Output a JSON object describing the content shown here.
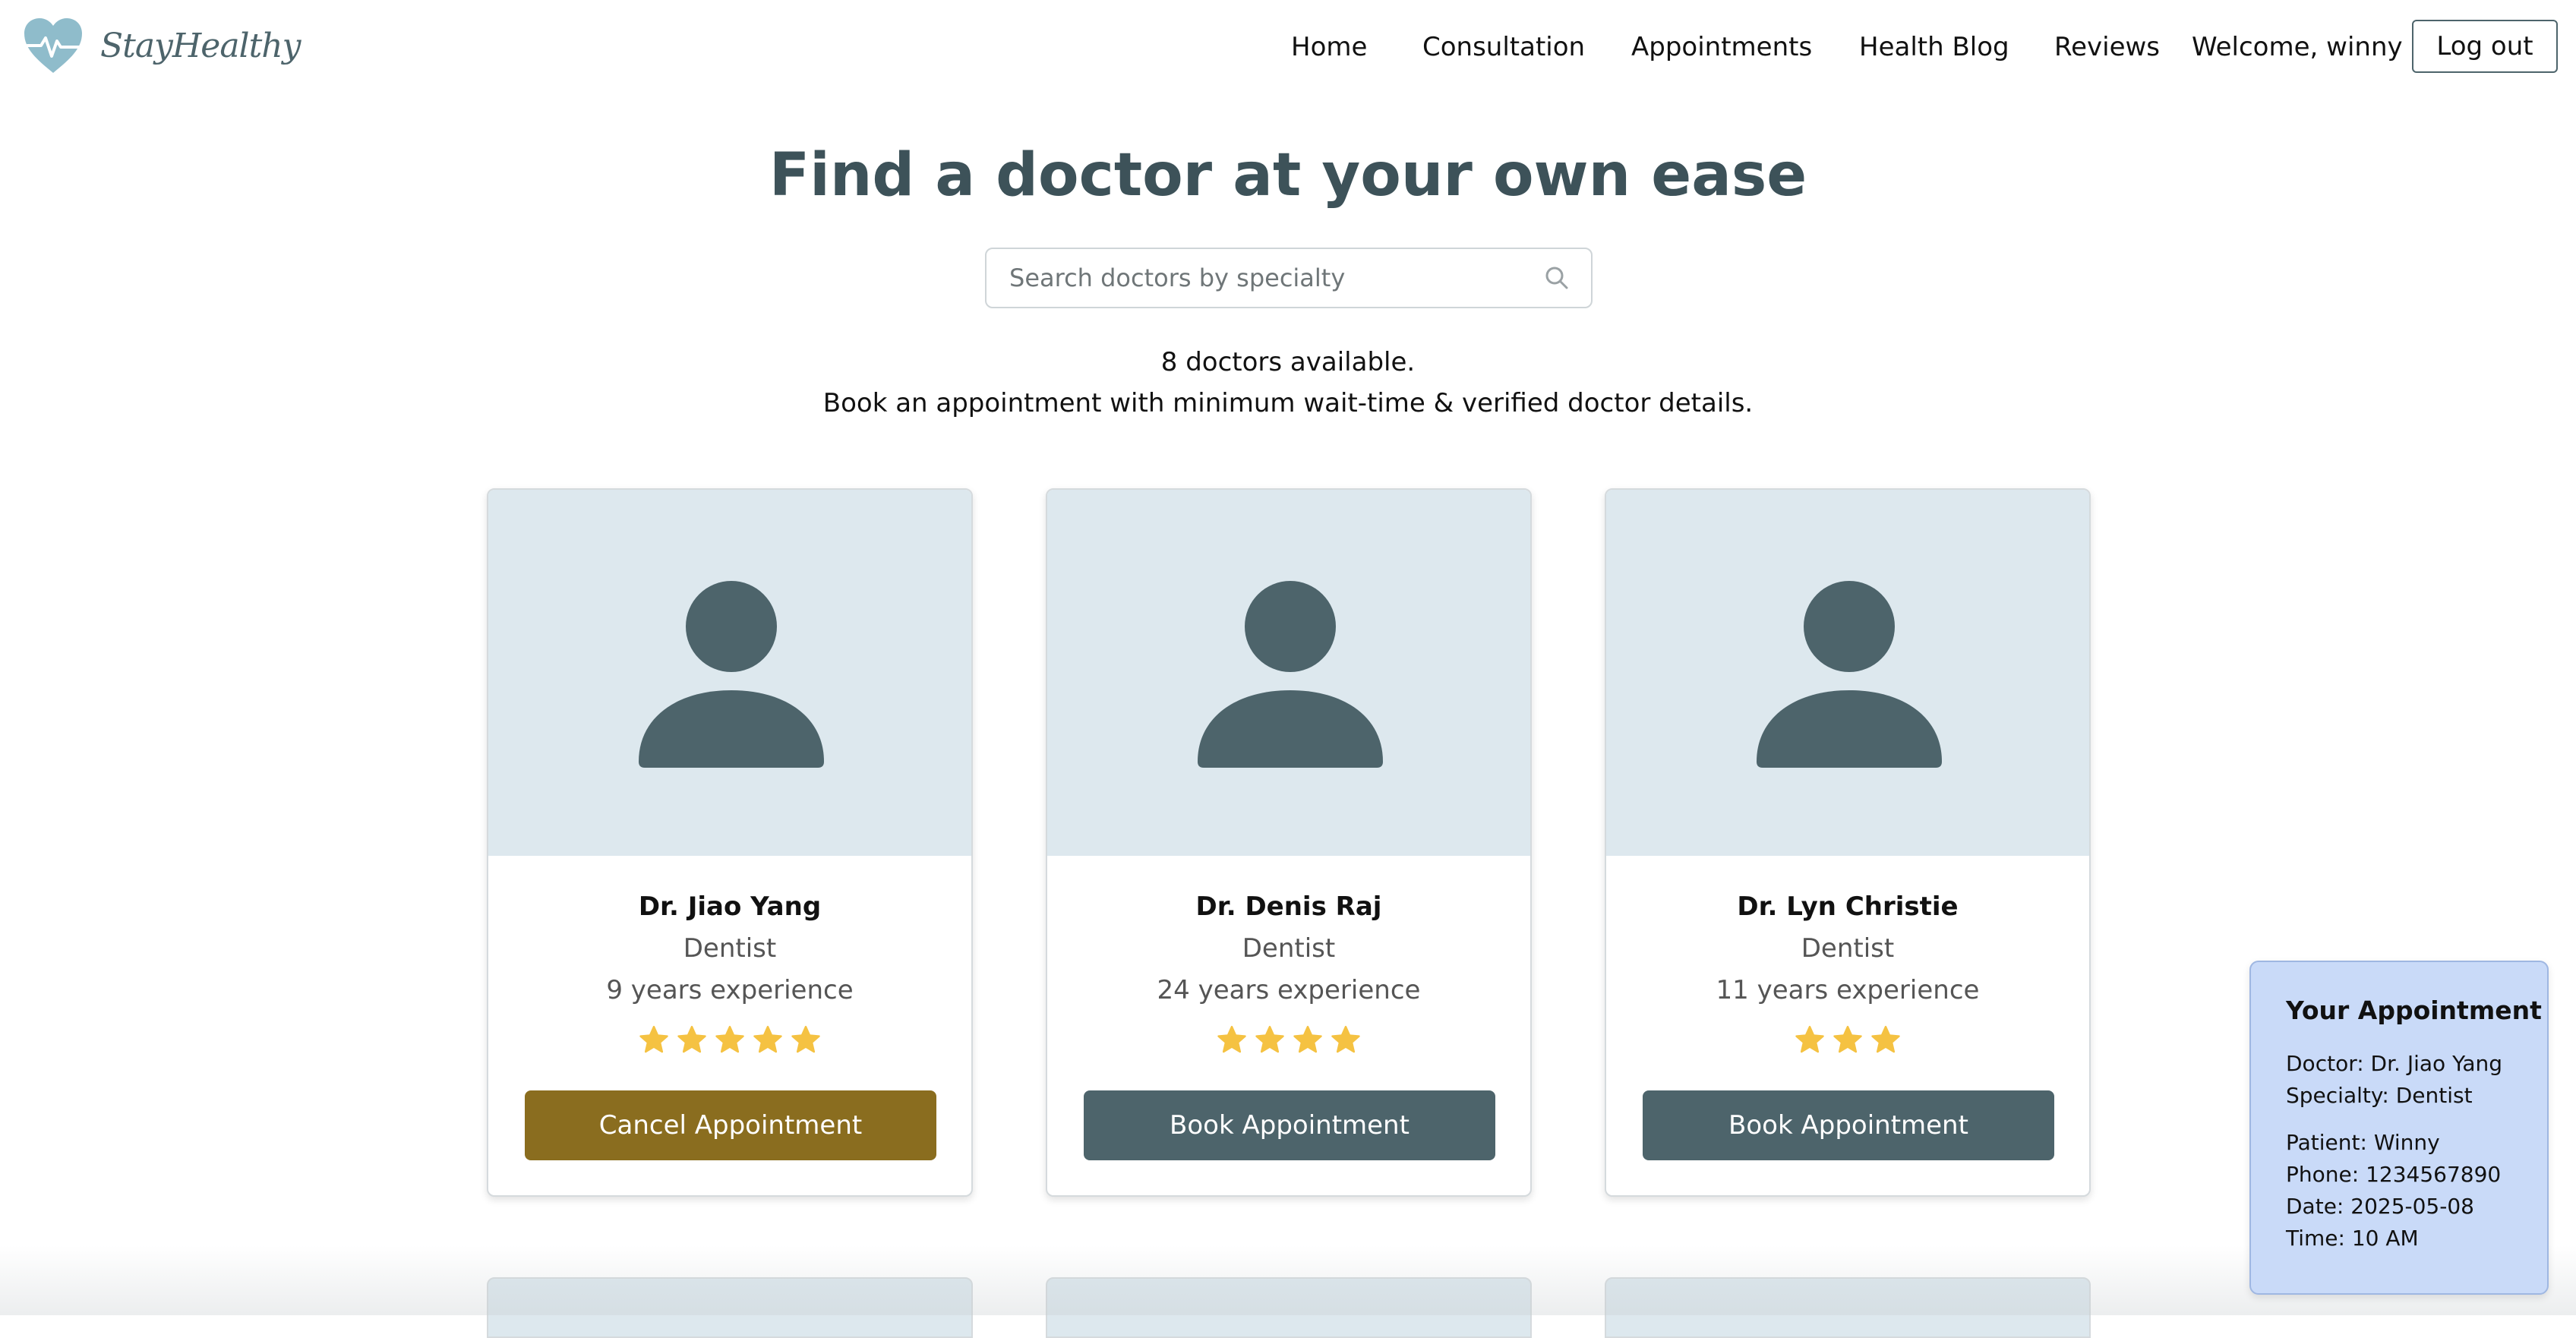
{
  "brand": {
    "name": "StayHealthy",
    "logo_icon": "heart-pulse-icon",
    "logo_color": "#8fbccb"
  },
  "nav": {
    "links": [
      "Home",
      "Consultation",
      "Appointments",
      "Health Blog",
      "Reviews"
    ],
    "welcome": "Welcome, winny",
    "logout_label": "Log out"
  },
  "hero": {
    "title": "Find a doctor at your own ease",
    "search_placeholder": "Search doctors by specialty",
    "search_icon": "search-icon",
    "available_text": "8 doctors available.",
    "tagline": "Book an appointment with minimum wait-time & verified doctor details."
  },
  "doctors": [
    {
      "name": "Dr. Jiao Yang",
      "specialty": "Dentist",
      "experience": "9 years experience",
      "rating": 5,
      "button_label": "Cancel Appointment",
      "button_kind": "cancel"
    },
    {
      "name": "Dr. Denis Raj",
      "specialty": "Dentist",
      "experience": "24 years experience",
      "rating": 4,
      "button_label": "Book Appointment",
      "button_kind": "book"
    },
    {
      "name": "Dr. Lyn Christie",
      "specialty": "Dentist",
      "experience": "11 years experience",
      "rating": 3,
      "button_label": "Book Appointment",
      "button_kind": "book"
    }
  ],
  "appointment": {
    "title": "Your Appointment",
    "doctor": "Doctor: Dr. Jiao Yang",
    "specialty": "Specialty: Dentist",
    "patient": "Patient: Winny",
    "phone": "Phone: 1234567890",
    "date": "Date: 2025-05-08",
    "time": "Time: 10 AM"
  },
  "colors": {
    "primary": "#4d646b",
    "cancel": "#8a6d1f",
    "star": "#f5c242",
    "card_image_bg": "#dde8ee",
    "panel_bg": "#c9daf8",
    "title": "#3d5259"
  }
}
